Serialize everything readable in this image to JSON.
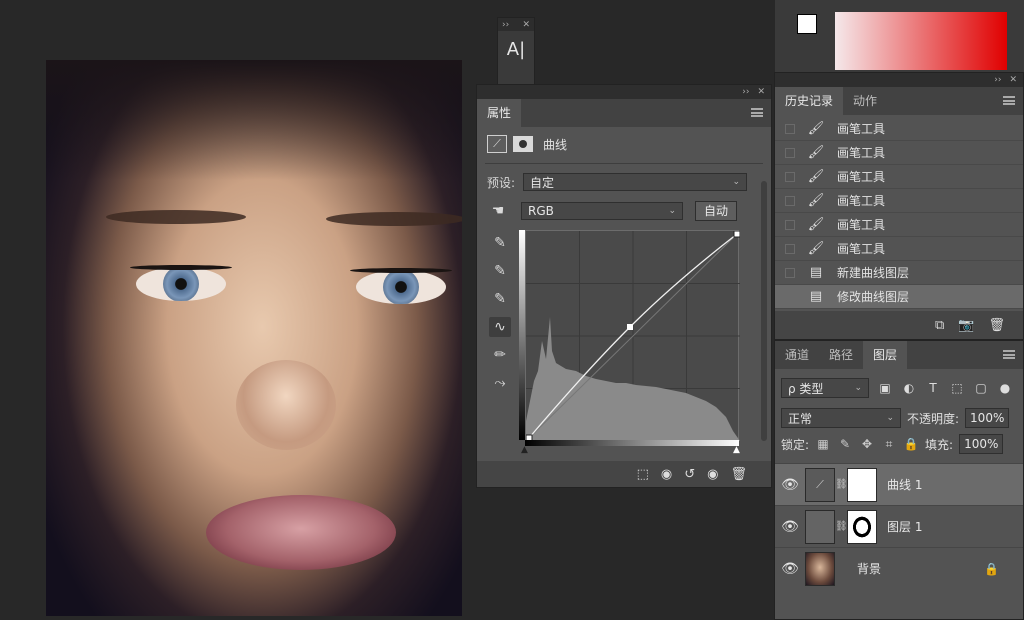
{
  "mini_panel": {
    "text": "A|",
    "expand": "››",
    "close": "✕"
  },
  "properties": {
    "tab": "属性",
    "title": "曲线",
    "preset_label": "预设:",
    "preset_value": "自定",
    "channel_value": "RGB",
    "auto_button": "自动"
  },
  "history": {
    "tab_history": "历史记录",
    "tab_actions": "动作",
    "items": [
      {
        "label": "画笔工具",
        "icon": "brush-icon"
      },
      {
        "label": "画笔工具",
        "icon": "brush-icon"
      },
      {
        "label": "画笔工具",
        "icon": "brush-icon"
      },
      {
        "label": "画笔工具",
        "icon": "brush-icon"
      },
      {
        "label": "画笔工具",
        "icon": "brush-icon"
      },
      {
        "label": "画笔工具",
        "icon": "brush-icon"
      },
      {
        "label": "新建曲线图层",
        "icon": "document-icon"
      },
      {
        "label": "修改曲线图层",
        "icon": "document-icon"
      }
    ]
  },
  "layers": {
    "tab_channels": "通道",
    "tab_paths": "路径",
    "tab_layers": "图层",
    "filter_kind": "ρ 类型",
    "blend_mode": "正常",
    "opacity_label": "不透明度:",
    "opacity_value": "100%",
    "lock_label": "锁定:",
    "fill_label": "填充:",
    "fill_value": "100%",
    "items": [
      {
        "name": "曲线 1"
      },
      {
        "name": "图层 1"
      },
      {
        "name": "背景"
      }
    ]
  },
  "colors": {
    "panel": "#535353",
    "panel_dark": "#424242",
    "background": "#282828",
    "accent_red": "#e00000"
  }
}
